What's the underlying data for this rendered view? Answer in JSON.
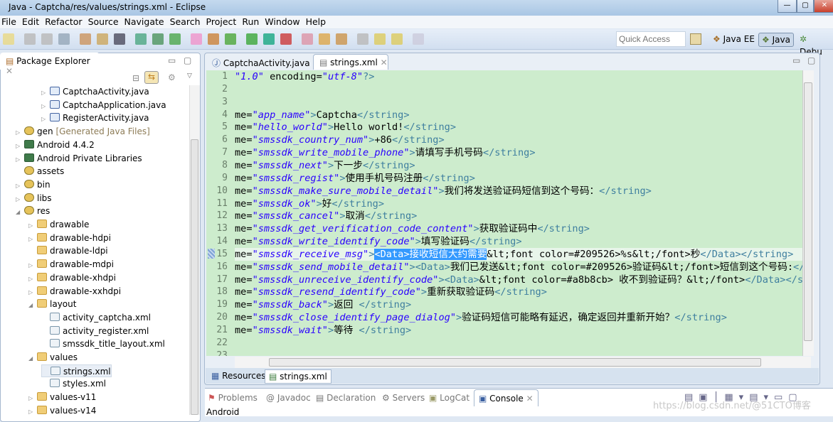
{
  "window": {
    "title": "Java - Captcha/res/values/strings.xml - Eclipse"
  },
  "menu": [
    "File",
    "Edit",
    "Refactor",
    "Source",
    "Navigate",
    "Search",
    "Project",
    "Run",
    "Window",
    "Help"
  ],
  "toolbar": {
    "quick_access_placeholder": "Quick Access",
    "perspectives": [
      "Java EE",
      "Java",
      "Debu"
    ],
    "active_perspective": "Java"
  },
  "package_explorer": {
    "title": "Package Explorer",
    "items": [
      {
        "label": "CaptchaActivity.java",
        "depth": 3,
        "twisty": "collapsed",
        "icon": "java-file"
      },
      {
        "label": "CaptchaApplication.java",
        "depth": 3,
        "twisty": "collapsed",
        "icon": "java-file"
      },
      {
        "label": "RegisterActivity.java",
        "depth": 3,
        "twisty": "collapsed",
        "icon": "java-file"
      },
      {
        "label": "gen",
        "suffix": "[Generated Java Files]",
        "depth": 1,
        "twisty": "collapsed",
        "icon": "package-folder"
      },
      {
        "label": "Android 4.4.2",
        "depth": 1,
        "twisty": "collapsed",
        "icon": "library"
      },
      {
        "label": "Android Private Libraries",
        "depth": 1,
        "twisty": "collapsed",
        "icon": "library"
      },
      {
        "label": "assets",
        "depth": 1,
        "twisty": "none",
        "icon": "package-folder"
      },
      {
        "label": "bin",
        "depth": 1,
        "twisty": "collapsed",
        "icon": "package-folder"
      },
      {
        "label": "libs",
        "depth": 1,
        "twisty": "collapsed",
        "icon": "package-folder"
      },
      {
        "label": "res",
        "depth": 1,
        "twisty": "expanded",
        "icon": "package-folder"
      },
      {
        "label": "drawable",
        "depth": 2,
        "twisty": "collapsed",
        "icon": "folder"
      },
      {
        "label": "drawable-hdpi",
        "depth": 2,
        "twisty": "collapsed",
        "icon": "folder"
      },
      {
        "label": "drawable-ldpi",
        "depth": 2,
        "twisty": "none",
        "icon": "folder"
      },
      {
        "label": "drawable-mdpi",
        "depth": 2,
        "twisty": "collapsed",
        "icon": "folder"
      },
      {
        "label": "drawable-xhdpi",
        "depth": 2,
        "twisty": "collapsed",
        "icon": "folder"
      },
      {
        "label": "drawable-xxhdpi",
        "depth": 2,
        "twisty": "collapsed",
        "icon": "folder"
      },
      {
        "label": "layout",
        "depth": 2,
        "twisty": "expanded",
        "icon": "folder"
      },
      {
        "label": "activity_captcha.xml",
        "depth": 3,
        "twisty": "none",
        "icon": "xml-file"
      },
      {
        "label": "activity_register.xml",
        "depth": 3,
        "twisty": "none",
        "icon": "xml-file"
      },
      {
        "label": "smssdk_title_layout.xml",
        "depth": 3,
        "twisty": "none",
        "icon": "xml-file"
      },
      {
        "label": "values",
        "depth": 2,
        "twisty": "expanded",
        "icon": "folder"
      },
      {
        "label": "strings.xml",
        "depth": 3,
        "twisty": "none",
        "icon": "xml-file",
        "selected": true
      },
      {
        "label": "styles.xml",
        "depth": 3,
        "twisty": "none",
        "icon": "xml-file"
      },
      {
        "label": "values-v11",
        "depth": 2,
        "twisty": "collapsed",
        "icon": "folder"
      },
      {
        "label": "values-v14",
        "depth": 2,
        "twisty": "collapsed",
        "icon": "folder"
      }
    ]
  },
  "editor": {
    "tabs": [
      {
        "label": "CaptchaActivity.java",
        "active": false
      },
      {
        "label": "strings.xml",
        "active": true
      }
    ],
    "bottom_tabs": [
      "Resources",
      "strings.xml"
    ],
    "current_line": 15,
    "lines": [
      [
        [
          "attr",
          "\"1.0\""
        ],
        [
          "text",
          " encoding="
        ],
        [
          "attr",
          "\"utf-8\""
        ],
        [
          "tag",
          "?>"
        ]
      ],
      [],
      [],
      [
        [
          "text",
          "me="
        ],
        [
          "attr",
          "\"app_name\""
        ],
        [
          "tag",
          ">"
        ],
        [
          "text",
          "Captcha"
        ],
        [
          "tag",
          "</string>"
        ]
      ],
      [
        [
          "text",
          "me="
        ],
        [
          "attr",
          "\"hello_world\""
        ],
        [
          "tag",
          ">"
        ],
        [
          "text",
          "Hello world!"
        ],
        [
          "tag",
          "</string>"
        ]
      ],
      [
        [
          "text",
          "me="
        ],
        [
          "attr",
          "\"smssdk_country_num\""
        ],
        [
          "tag",
          ">"
        ],
        [
          "text",
          "+86"
        ],
        [
          "tag",
          "</string>"
        ]
      ],
      [
        [
          "text",
          "me="
        ],
        [
          "attr",
          "\"smssdk_write_mobile_phone\""
        ],
        [
          "tag",
          ">"
        ],
        [
          "text",
          "请填写手机号码"
        ],
        [
          "tag",
          "</string>"
        ]
      ],
      [
        [
          "text",
          "me="
        ],
        [
          "attr",
          "\"smssdk_next\""
        ],
        [
          "tag",
          ">"
        ],
        [
          "text",
          "下一步"
        ],
        [
          "tag",
          "</string>"
        ]
      ],
      [
        [
          "text",
          "me="
        ],
        [
          "attr",
          "\"smssdk_regist\""
        ],
        [
          "tag",
          ">"
        ],
        [
          "text",
          "使用手机号码注册"
        ],
        [
          "tag",
          "</string>"
        ]
      ],
      [
        [
          "text",
          "me="
        ],
        [
          "attr",
          "\"smssdk_make_sure_mobile_detail\""
        ],
        [
          "tag",
          ">"
        ],
        [
          "text",
          "我们将发送验证码短信到这个号码："
        ],
        [
          "tag",
          "</string>"
        ]
      ],
      [
        [
          "text",
          "me="
        ],
        [
          "attr",
          "\"smssdk_ok\""
        ],
        [
          "tag",
          ">"
        ],
        [
          "text",
          "好"
        ],
        [
          "tag",
          "</string>"
        ]
      ],
      [
        [
          "text",
          "me="
        ],
        [
          "attr",
          "\"smssdk_cancel\""
        ],
        [
          "tag",
          ">"
        ],
        [
          "text",
          "取消"
        ],
        [
          "tag",
          "</string>"
        ]
      ],
      [
        [
          "text",
          "me="
        ],
        [
          "attr",
          "\"smssdk_get_verification_code_content\""
        ],
        [
          "tag",
          ">"
        ],
        [
          "text",
          "获取验证码中"
        ],
        [
          "tag",
          "</string>"
        ]
      ],
      [
        [
          "text",
          "me="
        ],
        [
          "attr",
          "\"smssdk_write_identify_code\""
        ],
        [
          "tag",
          ">"
        ],
        [
          "text",
          "填写验证码"
        ],
        [
          "tag",
          "</string>"
        ]
      ],
      [
        [
          "text",
          "me="
        ],
        [
          "attr",
          "\"smssdk_receive_msg\""
        ],
        [
          "tag",
          ">"
        ],
        [
          "sel",
          "<Data>接收短信大约需要"
        ],
        [
          "text",
          "&lt;font color=#209526>%s&lt;/font>秒"
        ],
        [
          "tag",
          "</Data></string>"
        ]
      ],
      [
        [
          "text",
          "me="
        ],
        [
          "attr",
          "\"smssdk_send_mobile_detail\""
        ],
        [
          "tag",
          "><Data>"
        ],
        [
          "text",
          "我们已发送&lt;font color=#209526>验证码&lt;/font>短信到这个号码:"
        ],
        [
          "tag",
          "</Da"
        ]
      ],
      [
        [
          "text",
          "me="
        ],
        [
          "attr",
          "\"smssdk_unreceive_identify_code\""
        ],
        [
          "tag",
          "><Data>"
        ],
        [
          "text",
          "&lt;font color=#a8b8cb> 收不到验证码？&lt;/font>"
        ],
        [
          "tag",
          "</Data></s"
        ]
      ],
      [
        [
          "text",
          "me="
        ],
        [
          "attr",
          "\"smssdk_resend_identify_code\""
        ],
        [
          "tag",
          ">"
        ],
        [
          "text",
          "重新获取验证码"
        ],
        [
          "tag",
          "</string>"
        ]
      ],
      [
        [
          "text",
          "me="
        ],
        [
          "attr",
          "\"smssdk_back\""
        ],
        [
          "tag",
          ">"
        ],
        [
          "text",
          "返回 "
        ],
        [
          "tag",
          "</string>"
        ]
      ],
      [
        [
          "text",
          "me="
        ],
        [
          "attr",
          "\"smssdk_close_identify_page_dialog\""
        ],
        [
          "tag",
          ">"
        ],
        [
          "text",
          "验证码短信可能略有延迟，确定返回并重新开始？"
        ],
        [
          "tag",
          "</string>"
        ]
      ],
      [
        [
          "text",
          "me="
        ],
        [
          "attr",
          "\"smssdk_wait\""
        ],
        [
          "tag",
          ">"
        ],
        [
          "text",
          "等待 "
        ],
        [
          "tag",
          "</string>"
        ]
      ],
      [],
      []
    ]
  },
  "bottom_panel": {
    "tabs": [
      "Problems",
      "Javadoc",
      "Declaration",
      "Servers",
      "LogCat",
      "Console"
    ],
    "active_tab": "Console",
    "console_text": "Android"
  },
  "watermark": "https://blog.csdn.net/@51CTO博客",
  "colors": {
    "editor_bg": "#cdeccd",
    "selection": "#3399ff",
    "attr": "#2a00ff",
    "tag": "#3f7f9f"
  }
}
